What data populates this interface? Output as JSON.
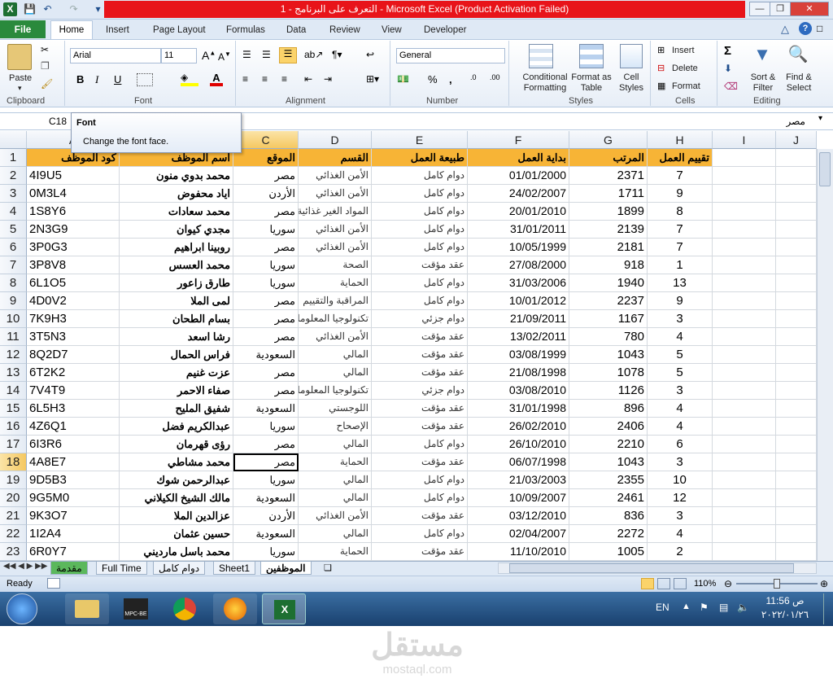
{
  "window": {
    "title": "التعرف على البرنامج - 1  -  Microsoft Excel (Product Activation Failed)"
  },
  "ribbon": {
    "tabs": [
      "File",
      "Home",
      "Insert",
      "Page Layout",
      "Formulas",
      "Data",
      "Review",
      "View",
      "Developer"
    ],
    "clipboard": {
      "paste": "Paste",
      "group": "Clipboard"
    },
    "font": {
      "name": "Arial",
      "size": "11",
      "group": "Font"
    },
    "alignment": {
      "group": "Alignment"
    },
    "number": {
      "format": "General",
      "group": "Number"
    },
    "styles": {
      "conditional": "Conditional Formatting",
      "format_table": "Format as Table",
      "cell_styles": "Cell Styles",
      "group": "Styles"
    },
    "cells": {
      "insert": "Insert",
      "delete": "Delete",
      "format": "Format",
      "group": "Cells"
    },
    "editing": {
      "sigma": "Σ",
      "sort": "Sort & Filter",
      "find": "Find & Select",
      "group": "Editing"
    }
  },
  "formula_bar": {
    "name_box": "C18",
    "fx": "fx",
    "value": "مصر"
  },
  "tooltip": {
    "title": "Font",
    "text": "Change the font face."
  },
  "columns": [
    "A",
    "B",
    "C",
    "D",
    "E",
    "F",
    "G",
    "H",
    "I",
    "J"
  ],
  "header_row": {
    "A": "كود الموظف",
    "B": "اسم الموظف",
    "C": "الموقع",
    "D": "القسم",
    "E": "طبيعة العمل",
    "F": "بداية العمل",
    "G": "المرتب",
    "H": "تقييم العمل"
  },
  "rows": [
    {
      "n": "2",
      "A": "4I9U5",
      "B": "محمد بدوي منون",
      "C": "مصر",
      "D": "الأمن الغذائي",
      "E": "دوام كامل",
      "F": "01/01/2000",
      "G": "2371",
      "H": "7"
    },
    {
      "n": "3",
      "A": "0M3L4",
      "B": "اياد محفوض",
      "C": "الأردن",
      "D": "الأمن الغذائي",
      "E": "دوام كامل",
      "F": "24/02/2007",
      "G": "1711",
      "H": "9"
    },
    {
      "n": "4",
      "A": "1S8Y6",
      "B": "محمد سعادات",
      "C": "مصر",
      "D": "المواد الغير غذائية",
      "E": "دوام كامل",
      "F": "20/01/2010",
      "G": "1899",
      "H": "8"
    },
    {
      "n": "5",
      "A": "2N3G9",
      "B": "مجدي كيوان",
      "C": "سوريا",
      "D": "الأمن الغذائي",
      "E": "دوام كامل",
      "F": "31/01/2011",
      "G": "2139",
      "H": "7"
    },
    {
      "n": "6",
      "A": "3P0G3",
      "B": "روبينا ابراهيم",
      "C": "مصر",
      "D": "الأمن الغذائي",
      "E": "دوام كامل",
      "F": "10/05/1999",
      "G": "2181",
      "H": "7"
    },
    {
      "n": "7",
      "A": "3P8V8",
      "B": "محمد العسس",
      "C": "سوريا",
      "D": "الصحة",
      "E": "عقد مؤقت",
      "F": "27/08/2000",
      "G": "918",
      "H": "1"
    },
    {
      "n": "8",
      "A": "6L1O5",
      "B": "طارق زاعور",
      "C": "سوريا",
      "D": "الحماية",
      "E": "دوام كامل",
      "F": "31/03/2006",
      "G": "1940",
      "H": "13"
    },
    {
      "n": "9",
      "A": "4D0V2",
      "B": "لمى الملا",
      "C": "مصر",
      "D": "المراقبة والتقييم",
      "E": "دوام كامل",
      "F": "10/01/2012",
      "G": "2237",
      "H": "9"
    },
    {
      "n": "10",
      "A": "7K9H3",
      "B": "بسام الطحان",
      "C": "مصر",
      "D": "تكنولوجيا المعلومات",
      "E": "دوام جزئي",
      "F": "21/09/2011",
      "G": "1167",
      "H": "3"
    },
    {
      "n": "11",
      "A": "3T5N3",
      "B": "رشا اسعد",
      "C": "مصر",
      "D": "الأمن الغذائي",
      "E": "عقد مؤقت",
      "F": "13/02/2011",
      "G": "780",
      "H": "4"
    },
    {
      "n": "12",
      "A": "8Q2D7",
      "B": "فراس الحمال",
      "C": "السعودية",
      "D": "المالي",
      "E": "عقد مؤقت",
      "F": "03/08/1999",
      "G": "1043",
      "H": "5"
    },
    {
      "n": "13",
      "A": "6T2K2",
      "B": "عزت غنيم",
      "C": "مصر",
      "D": "المالي",
      "E": "عقد مؤقت",
      "F": "21/08/1998",
      "G": "1078",
      "H": "5"
    },
    {
      "n": "14",
      "A": "7V4T9",
      "B": "صفاء الاحمر",
      "C": "مصر",
      "D": "تكنولوجيا المعلومات",
      "E": "دوام جزئي",
      "F": "03/08/2010",
      "G": "1126",
      "H": "3"
    },
    {
      "n": "15",
      "A": "6L5H3",
      "B": "شفيق المليح",
      "C": "السعودية",
      "D": "اللوجستي",
      "E": "عقد مؤقت",
      "F": "31/01/1998",
      "G": "896",
      "H": "4"
    },
    {
      "n": "16",
      "A": "4Z6Q1",
      "B": "عبدالكريم فضل",
      "C": "سوريا",
      "D": "الإصحاح",
      "E": "عقد مؤقت",
      "F": "26/02/2010",
      "G": "2406",
      "H": "4"
    },
    {
      "n": "17",
      "A": "6I3R6",
      "B": "رؤى قهرمان",
      "C": "مصر",
      "D": "المالي",
      "E": "دوام كامل",
      "F": "26/10/2010",
      "G": "2210",
      "H": "6"
    },
    {
      "n": "18",
      "A": "4A8E7",
      "B": "محمد  مشاطي",
      "C": "مصر",
      "D": "الحماية",
      "E": "عقد مؤقت",
      "F": "06/07/1998",
      "G": "1043",
      "H": "3"
    },
    {
      "n": "19",
      "A": "9D5B3",
      "B": "عبدالرحمن شوك",
      "C": "سوريا",
      "D": "المالي",
      "E": "دوام كامل",
      "F": "21/03/2003",
      "G": "2355",
      "H": "10"
    },
    {
      "n": "20",
      "A": "9G5M0",
      "B": "مالك الشيخ الكيلاني",
      "C": "السعودية",
      "D": "المالي",
      "E": "دوام كامل",
      "F": "10/09/2007",
      "G": "2461",
      "H": "12"
    },
    {
      "n": "21",
      "A": "9K3O7",
      "B": "عزالدين الملا",
      "C": "الأردن",
      "D": "الأمن الغذائي",
      "E": "عقد مؤقت",
      "F": "03/12/2010",
      "G": "836",
      "H": "3"
    },
    {
      "n": "22",
      "A": "1I2A4",
      "B": "حسين عثمان",
      "C": "السعودية",
      "D": "المالي",
      "E": "دوام كامل",
      "F": "02/04/2007",
      "G": "2272",
      "H": "4"
    },
    {
      "n": "23",
      "A": "6R0Y7",
      "B": "محمد باسل مارديني",
      "C": "سوريا",
      "D": "الحماية",
      "E": "عقد مؤقت",
      "F": "11/10/2010",
      "G": "1005",
      "H": "2"
    }
  ],
  "sheet_tabs": [
    "مقدمة",
    "Full Time",
    "دوام كامل",
    "Sheet1",
    "الموظفين"
  ],
  "status": {
    "ready": "Ready",
    "zoom": "110%"
  },
  "taskbar": {
    "lang": "EN",
    "time": "11:56 ص",
    "date": "٢٠٢٢/٠١/٢٦"
  },
  "watermark": {
    "arabic": "مستقل",
    "latin": "mostaql.com"
  }
}
